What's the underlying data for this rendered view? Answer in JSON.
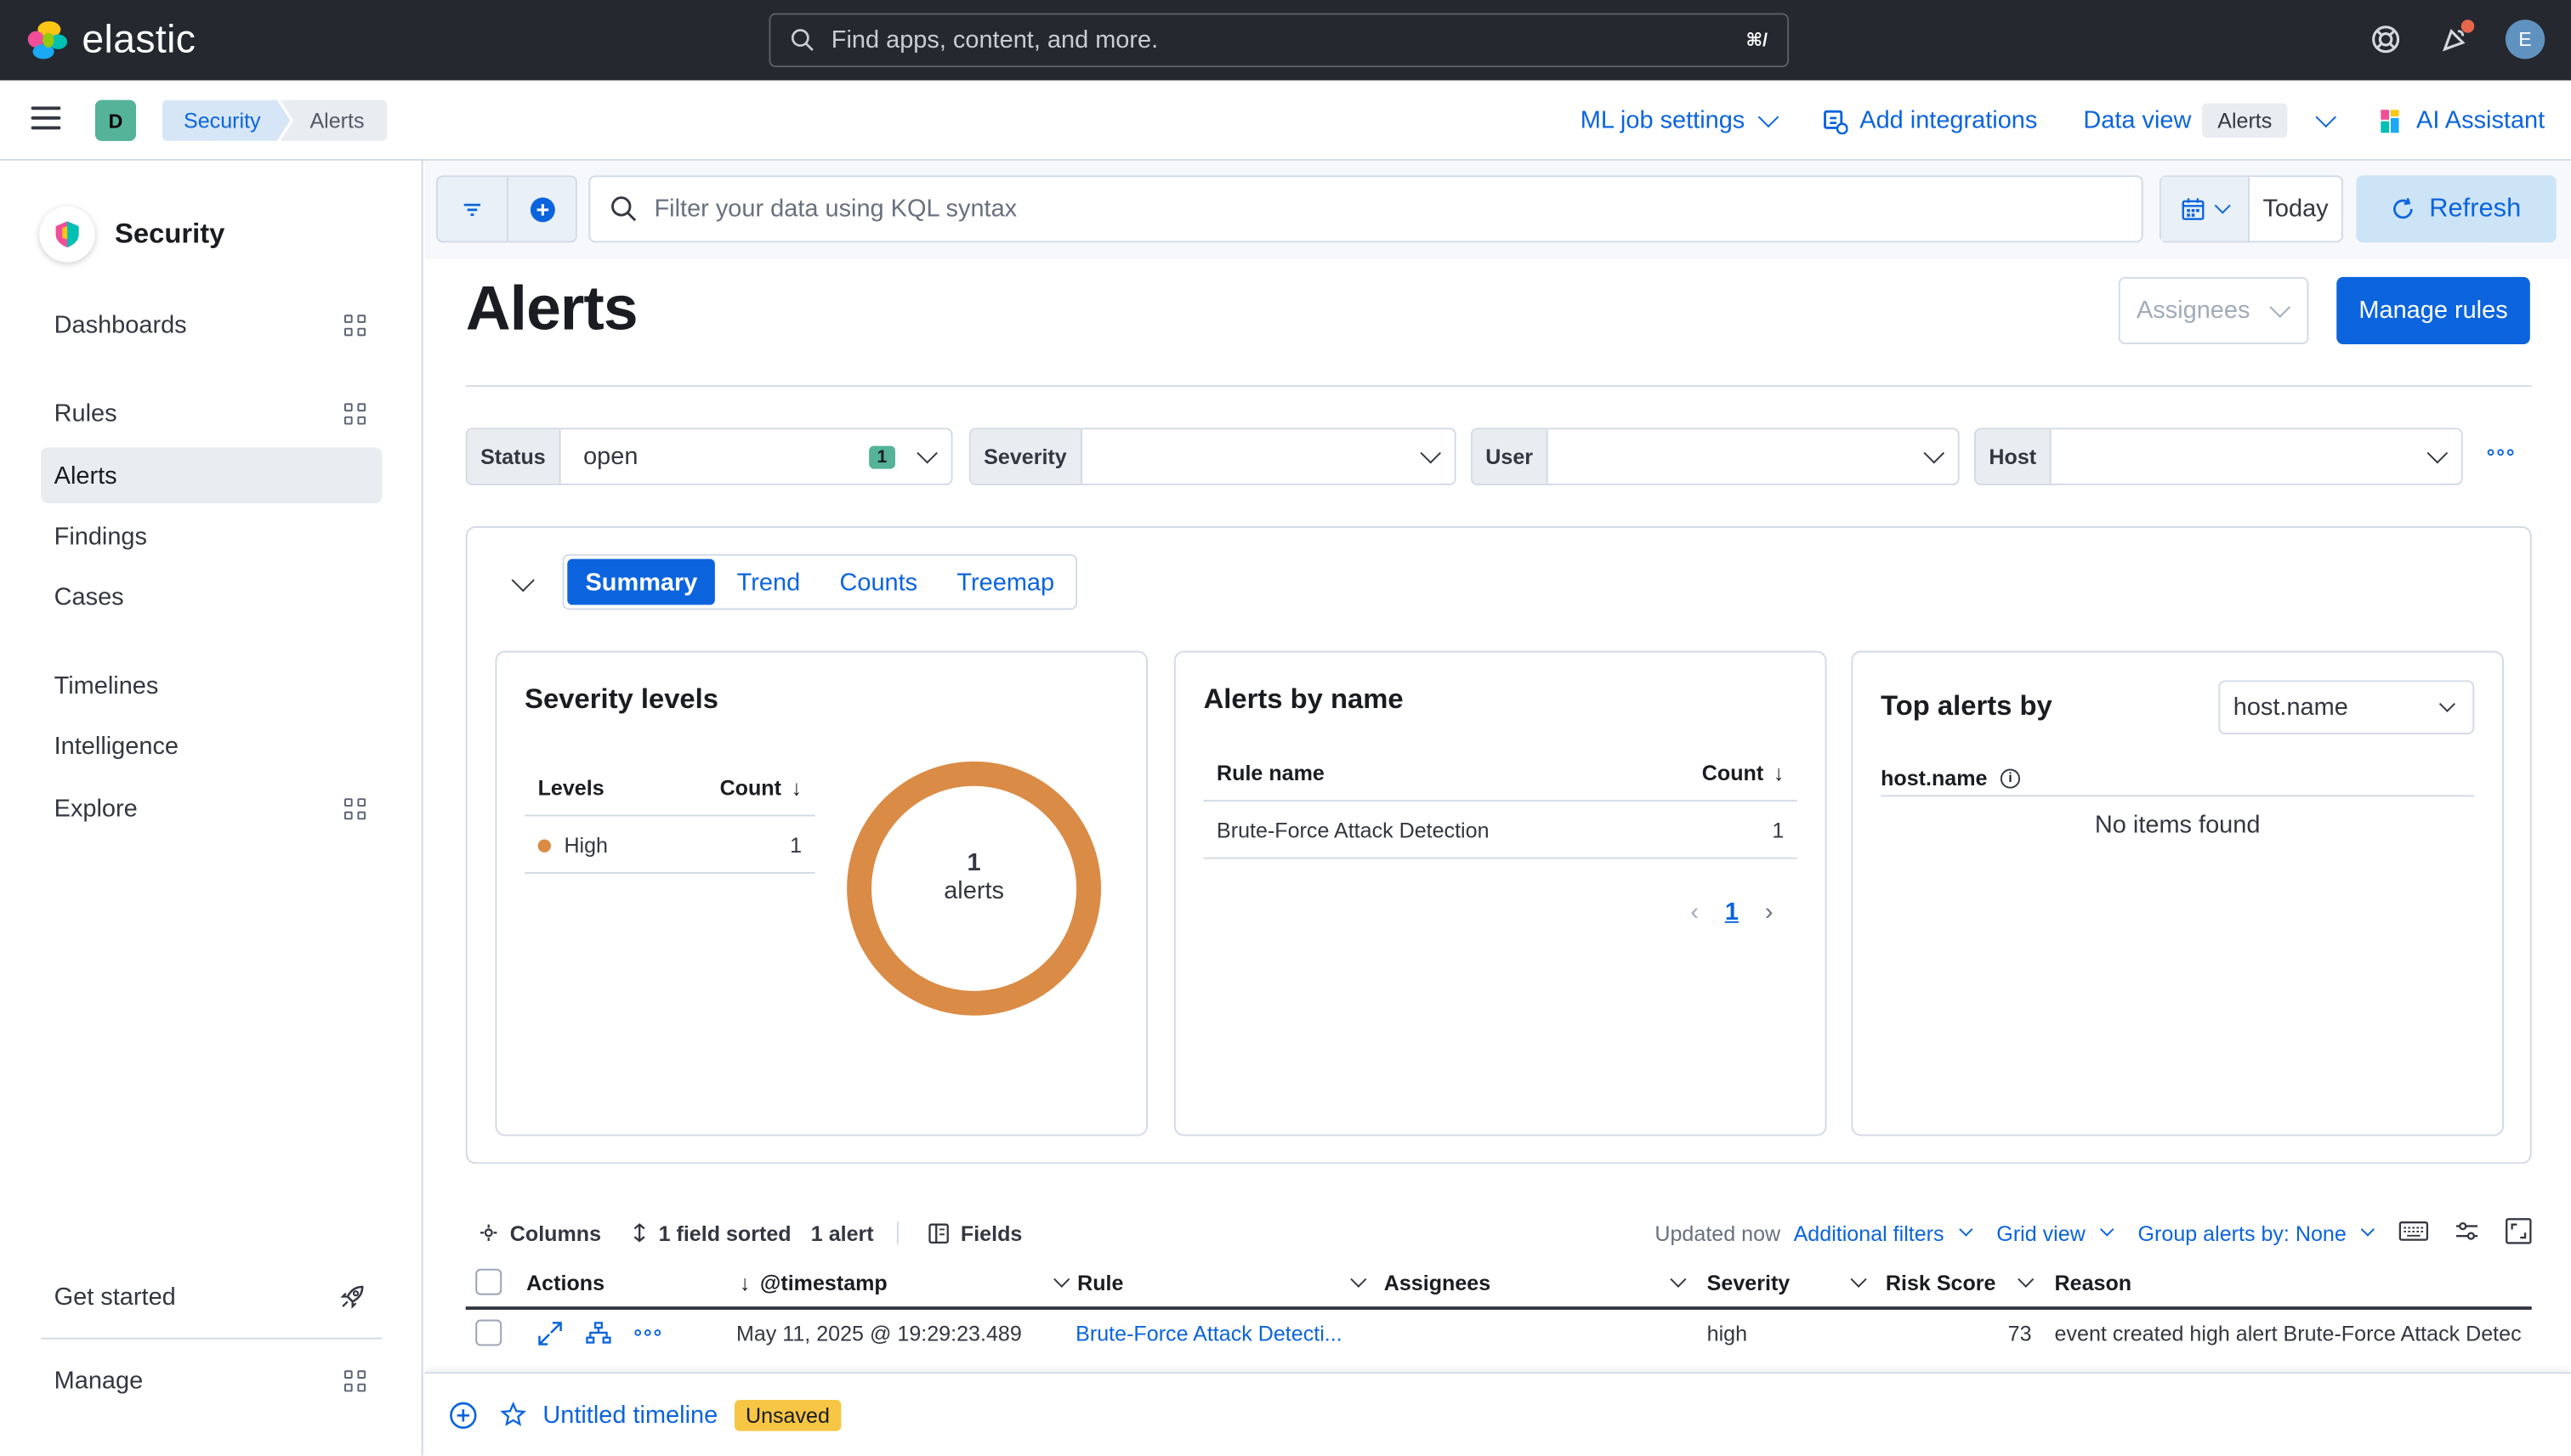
{
  "brand": {
    "name": "elastic"
  },
  "global_search": {
    "placeholder": "Find apps, content, and more.",
    "shortcut": "⌘/"
  },
  "user": {
    "initial": "E"
  },
  "space": {
    "initial": "D"
  },
  "breadcrumbs": [
    "Security",
    "Alerts"
  ],
  "header_nav": {
    "ml_job_settings": "ML job settings",
    "add_integrations": "Add integrations",
    "data_view_label": "Data view",
    "data_view_value": "Alerts",
    "ai_assistant": "AI Assistant"
  },
  "sidenav": {
    "title": "Security",
    "items": [
      {
        "label": "Dashboards",
        "has_grid_icon": true
      },
      {
        "label": "Rules",
        "has_grid_icon": true
      },
      {
        "label": "Alerts",
        "active": true
      },
      {
        "label": "Findings"
      },
      {
        "label": "Cases"
      },
      {
        "label": "Timelines"
      },
      {
        "label": "Intelligence"
      },
      {
        "label": "Explore",
        "has_grid_icon": true
      }
    ],
    "footer": [
      {
        "label": "Get started",
        "icon": "rocket-icon"
      },
      {
        "label": "Manage",
        "icon": "grid-icon"
      }
    ]
  },
  "query_bar": {
    "placeholder": "Filter your data using KQL syntax",
    "date": "Today",
    "refresh_label": "Refresh"
  },
  "page": {
    "title": "Alerts",
    "assignees_label": "Assignees",
    "manage_rules_label": "Manage rules"
  },
  "filters": [
    {
      "label": "Status",
      "value": "open",
      "count": "1"
    },
    {
      "label": "Severity",
      "value": ""
    },
    {
      "label": "User",
      "value": ""
    },
    {
      "label": "Host",
      "value": ""
    }
  ],
  "tabs": [
    "Summary",
    "Trend",
    "Counts",
    "Treemap"
  ],
  "severity_card": {
    "title": "Severity levels",
    "col_levels": "Levels",
    "col_count": "Count",
    "rows": [
      {
        "level": "High",
        "count": "1",
        "color": "#da8b45"
      }
    ],
    "donut_value": "1",
    "donut_label": "alerts"
  },
  "alerts_by_name_card": {
    "title": "Alerts by name",
    "col_rule": "Rule name",
    "col_count": "Count",
    "rows": [
      {
        "rule": "Brute-Force Attack Detection",
        "count": "1"
      }
    ],
    "page": "1"
  },
  "top_alerts_card": {
    "title": "Top alerts by",
    "select_value": "host.name",
    "column": "host.name",
    "empty": "No items found"
  },
  "table_toolbar": {
    "columns": "Columns",
    "sorted": "1 field sorted",
    "count": "1 alert",
    "fields": "Fields",
    "updated": "Updated now",
    "additional_filters": "Additional filters",
    "grid_view": "Grid view",
    "group_by": "Group alerts by: None"
  },
  "table": {
    "headers": [
      "Actions",
      "@timestamp",
      "Rule",
      "Assignees",
      "Severity",
      "Risk Score",
      "Reason"
    ],
    "rows": [
      {
        "timestamp": "May 11, 2025 @ 19:29:23.489",
        "rule": "Brute-Force Attack Detecti...",
        "assignees": "",
        "severity": "high",
        "risk_score": "73",
        "reason": "event created high alert Brute-Force Attack Detec"
      }
    ]
  },
  "timeline": {
    "title": "Untitled timeline",
    "status": "Unsaved"
  },
  "colors": {
    "accent": "#0b64dd",
    "high_severity": "#da8b45",
    "topbar": "#25282f",
    "status_badge": "#54b399"
  }
}
